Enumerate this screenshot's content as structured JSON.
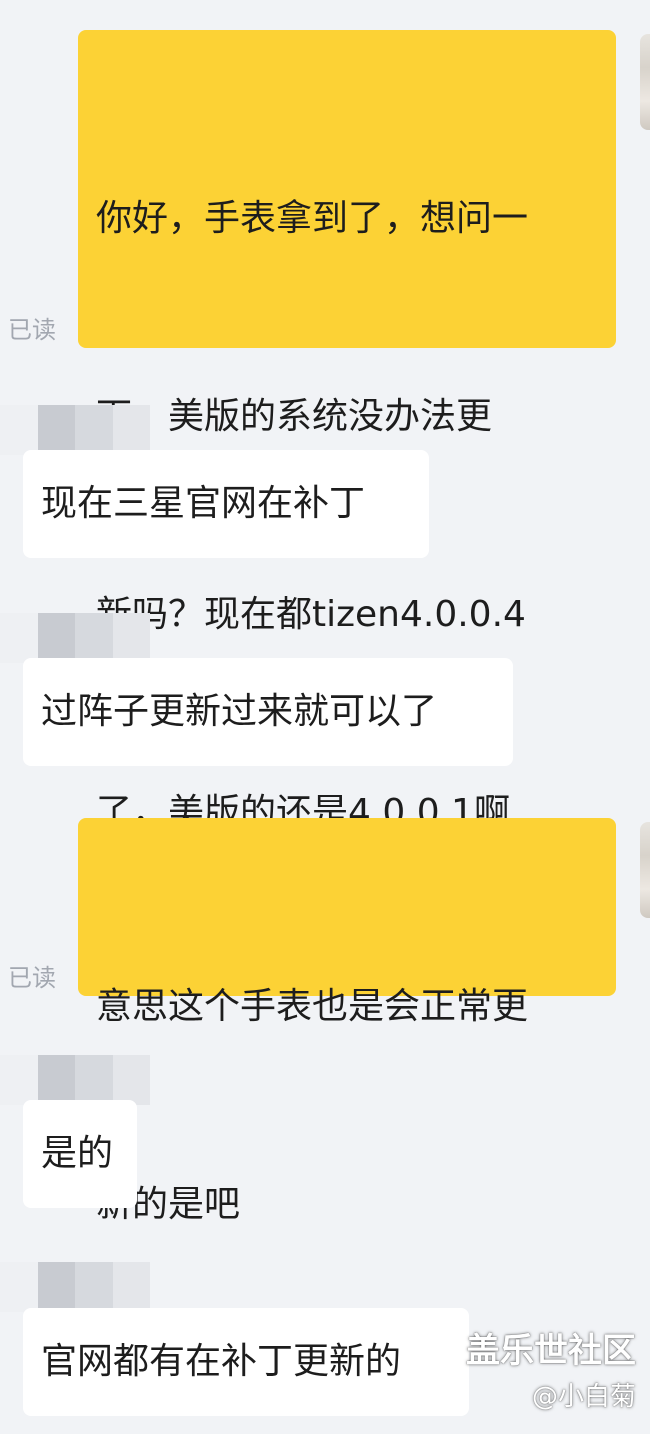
{
  "chat": {
    "read_label": "已读",
    "messages": [
      {
        "direction": "out",
        "lines": [
          "你好，手表拿到了，想问一",
          "下，美版的系统没办法更",
          "新吗？现在都tizen4.0.0.4",
          "了，美版的还是4.0.0.1啊"
        ],
        "status": "已读"
      },
      {
        "direction": "in",
        "text": "现在三星官网在补丁"
      },
      {
        "direction": "in",
        "text": "过阵子更新过来就可以了"
      },
      {
        "direction": "out",
        "lines": [
          "意思这个手表也是会正常更",
          "新的是吧"
        ],
        "status": "已读"
      },
      {
        "direction": "in",
        "text": "是的"
      },
      {
        "direction": "in",
        "text": "官网都有在补丁更新的"
      }
    ]
  },
  "watermark": {
    "site": "盖乐世社区",
    "user": "@小白菊"
  },
  "colors": {
    "background": "#f1f3f6",
    "outgoing_bubble": "#fcd235",
    "incoming_bubble": "#ffffff",
    "text": "#1d1d1d",
    "read_receipt": "#a2a7b0"
  },
  "icons": {
    "avatar": "avatar-image"
  }
}
